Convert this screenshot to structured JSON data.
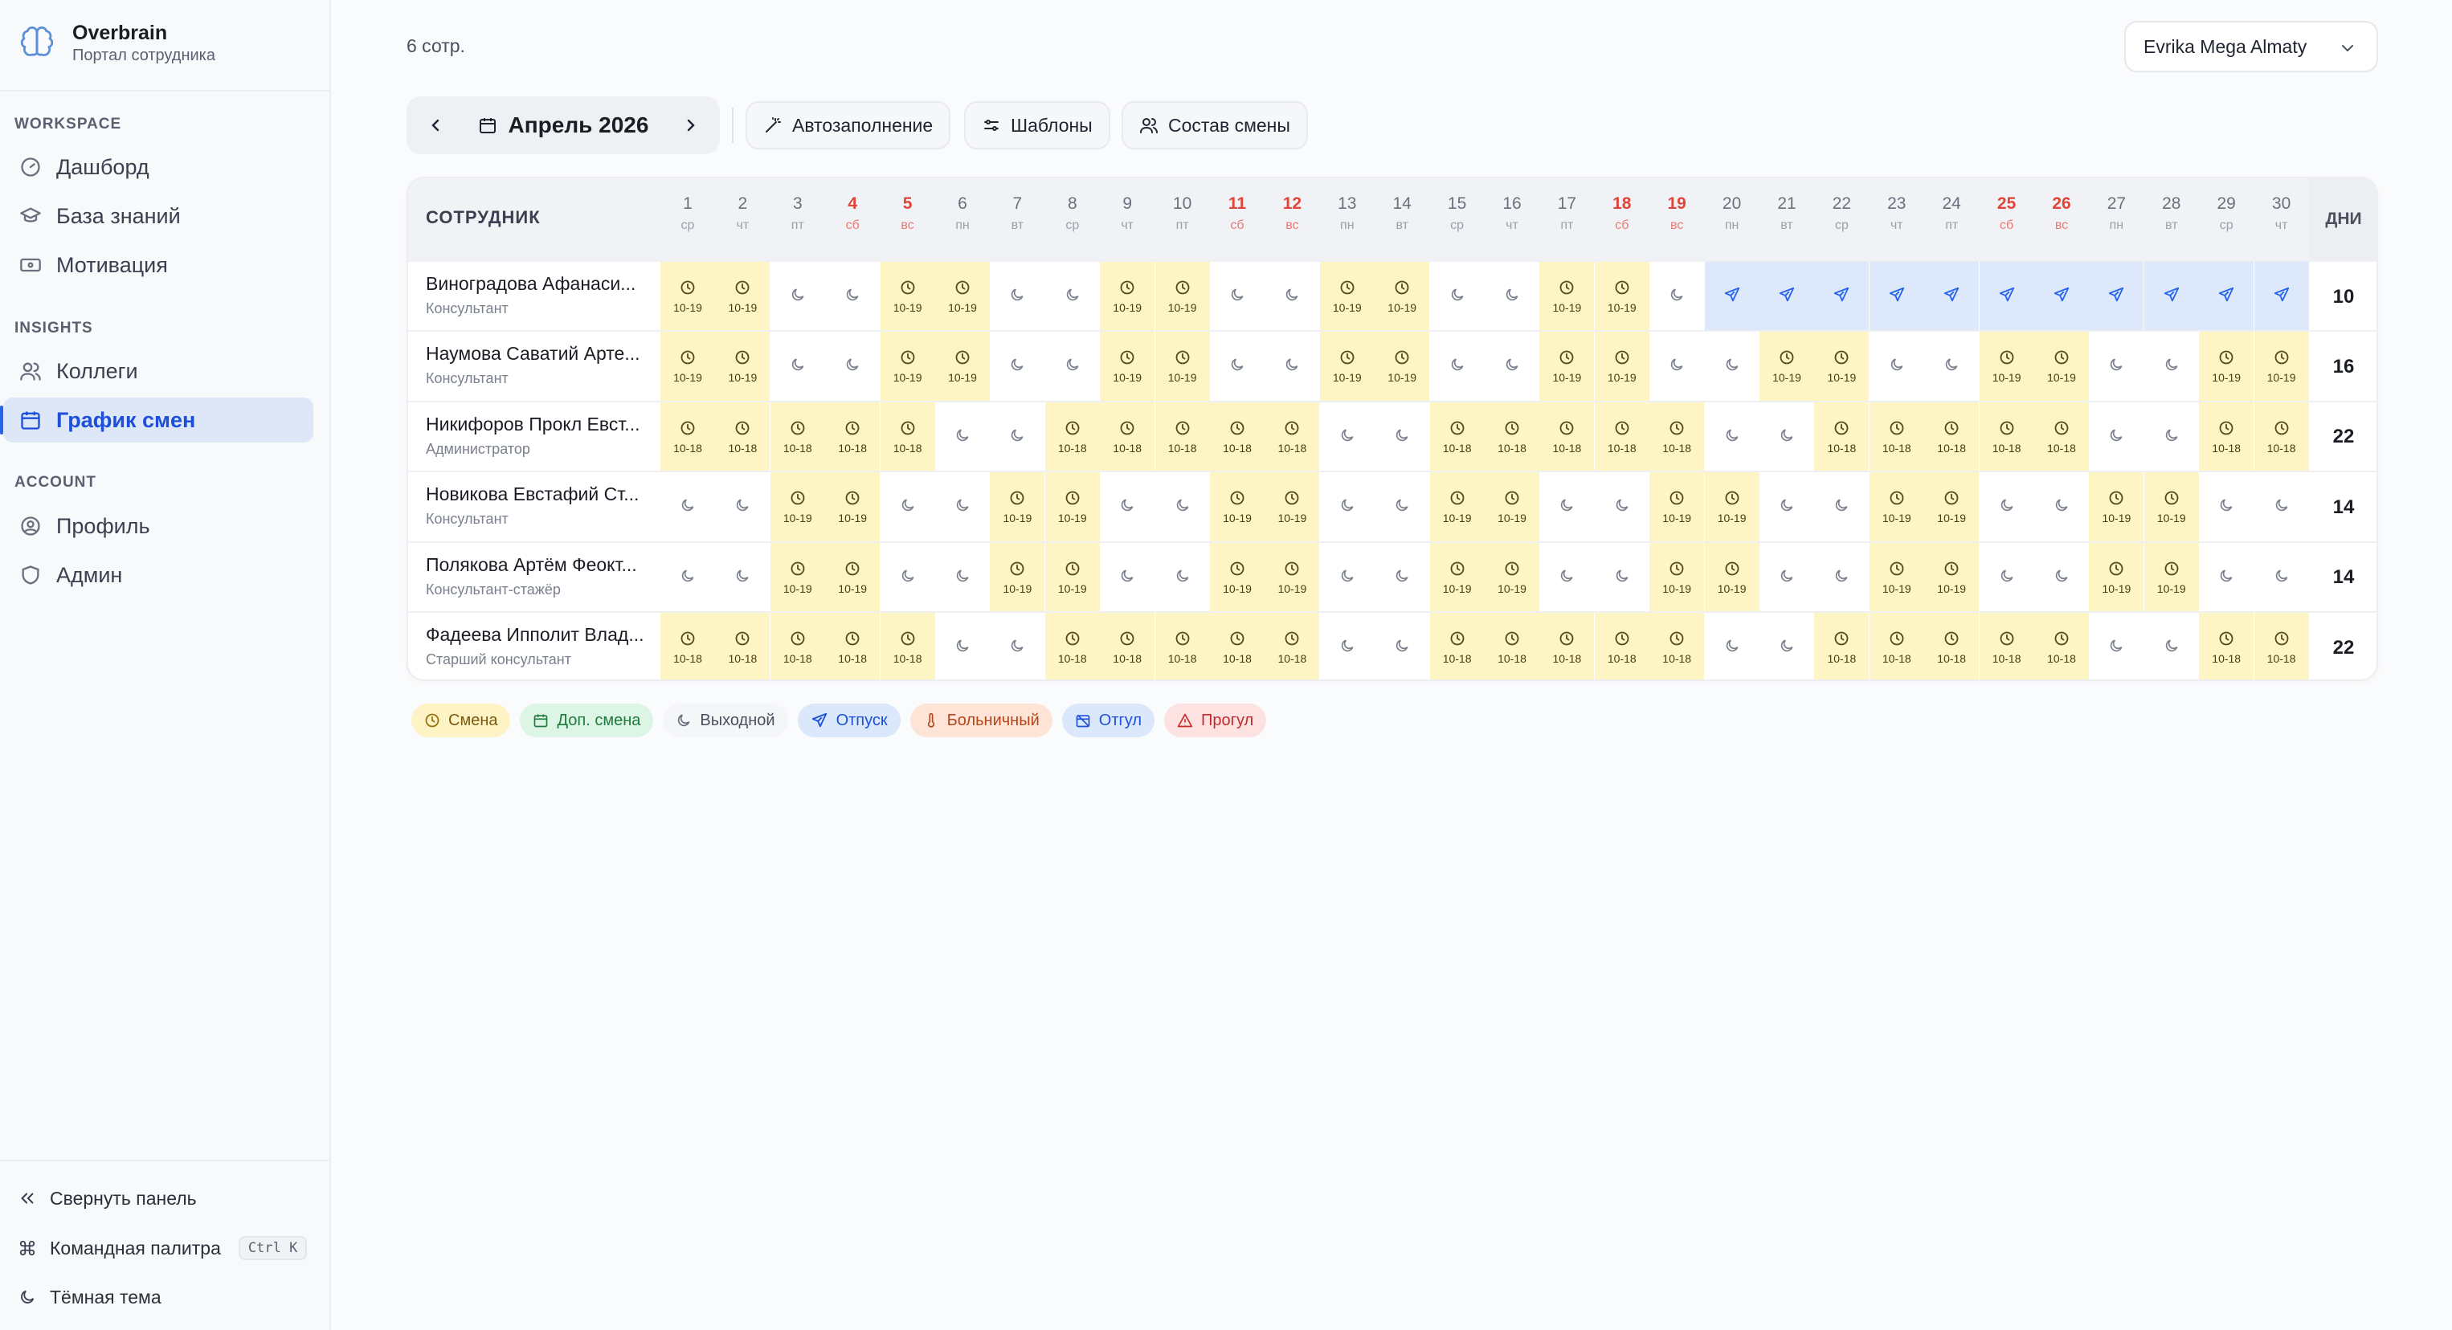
{
  "app": {
    "name": "Overbrain",
    "subtitle": "Портал сотрудника"
  },
  "sidebar": {
    "sections": [
      {
        "title": "WORKSPACE",
        "items": [
          {
            "label": "Дашборд",
            "icon": "gauge-icon"
          },
          {
            "label": "База знаний",
            "icon": "graduation-cap-icon"
          },
          {
            "label": "Мотивация",
            "icon": "banknote-icon"
          }
        ]
      },
      {
        "title": "INSIGHTS",
        "items": [
          {
            "label": "Коллеги",
            "icon": "users-icon"
          },
          {
            "label": "График смен",
            "icon": "calendar-icon",
            "active": true
          }
        ]
      },
      {
        "title": "ACCOUNT",
        "items": [
          {
            "label": "Профиль",
            "icon": "user-circle-icon"
          },
          {
            "label": "Админ",
            "icon": "shield-icon"
          }
        ]
      }
    ],
    "bottom": {
      "collapse": "Свернуть панель",
      "palette": "Командная палитра",
      "palette_kbd": "Ctrl K",
      "theme": "Тёмная тема"
    }
  },
  "header": {
    "employee_count": "6 сотр.",
    "store": "Evrika Mega Almaty"
  },
  "toolbar": {
    "month": "Апрель 2026",
    "autofill": "Автозаполнение",
    "templates": "Шаблоны",
    "crew": "Состав смены"
  },
  "table": {
    "employee_header": "СОТРУДНИК",
    "total_header": "ДНИ",
    "days": [
      {
        "n": "1",
        "w": "ср"
      },
      {
        "n": "2",
        "w": "чт"
      },
      {
        "n": "3",
        "w": "пт"
      },
      {
        "n": "4",
        "w": "сб",
        "we": true
      },
      {
        "n": "5",
        "w": "вс",
        "we": true
      },
      {
        "n": "6",
        "w": "пн"
      },
      {
        "n": "7",
        "w": "вт"
      },
      {
        "n": "8",
        "w": "ср"
      },
      {
        "n": "9",
        "w": "чт"
      },
      {
        "n": "10",
        "w": "пт"
      },
      {
        "n": "11",
        "w": "сб",
        "we": true
      },
      {
        "n": "12",
        "w": "вс",
        "we": true
      },
      {
        "n": "13",
        "w": "пн"
      },
      {
        "n": "14",
        "w": "вт"
      },
      {
        "n": "15",
        "w": "ср"
      },
      {
        "n": "16",
        "w": "чт"
      },
      {
        "n": "17",
        "w": "пт"
      },
      {
        "n": "18",
        "w": "сб",
        "we": true
      },
      {
        "n": "19",
        "w": "вс",
        "we": true
      },
      {
        "n": "20",
        "w": "пн"
      },
      {
        "n": "21",
        "w": "вт"
      },
      {
        "n": "22",
        "w": "ср"
      },
      {
        "n": "23",
        "w": "чт"
      },
      {
        "n": "24",
        "w": "пт"
      },
      {
        "n": "25",
        "w": "сб",
        "we": true
      },
      {
        "n": "26",
        "w": "вс",
        "we": true
      },
      {
        "n": "27",
        "w": "пн"
      },
      {
        "n": "28",
        "w": "вт"
      },
      {
        "n": "29",
        "w": "ср"
      },
      {
        "n": "30",
        "w": "чт"
      }
    ],
    "rows": [
      {
        "name": "Виноградова Афанаси...",
        "role": "Консультант",
        "total": "10",
        "cells": "SSOOSSOOSSOOSSOOSSOVVVVVVVVVVV",
        "time": "10-19"
      },
      {
        "name": "Наумова Саватий Арте...",
        "role": "Консультант",
        "total": "16",
        "cells": "SSOOSSOOSSOOSSOOSSOOSSOOSSOOSS",
        "time": "10-19"
      },
      {
        "name": "Никифоров Прокл Евст...",
        "role": "Администратор",
        "total": "22",
        "cells": "SSSSSOOSSSSSOOSSSSSOOSSSSSOOSS",
        "time": "10-18"
      },
      {
        "name": "Новикова Евстафий Ст...",
        "role": "Консультант",
        "total": "14",
        "cells": "OOSSOOSSOOSSOOSSOOSSOOSSOOSSOO",
        "time": "10-19"
      },
      {
        "name": "Полякова Артём Феокт...",
        "role": "Консультант-стажёр",
        "total": "14",
        "cells": "OOSSOOSSOOSSOOSSOOSSOOSSOOSSOO",
        "time": "10-19"
      },
      {
        "name": "Фадеева Ипполит Влад...",
        "role": "Старший консультант",
        "total": "22",
        "cells": "SSSSSOOSSSSSOOSSSSSOOSSSSSOOSS",
        "time": "10-18"
      }
    ]
  },
  "legend": [
    {
      "label": "Смена",
      "kind": "shift",
      "icon": "clock-icon"
    },
    {
      "label": "Доп. смена",
      "kind": "extra",
      "icon": "calendar-plus-icon"
    },
    {
      "label": "Выходной",
      "kind": "off",
      "icon": "moon-icon"
    },
    {
      "label": "Отпуск",
      "kind": "vac",
      "icon": "plane-icon"
    },
    {
      "label": "Больничный",
      "kind": "sick",
      "icon": "thermometer-icon"
    },
    {
      "label": "Отгул",
      "kind": "leave",
      "icon": "calendar-off-icon"
    },
    {
      "label": "Прогул",
      "kind": "abs",
      "icon": "alert-triangle-icon"
    }
  ],
  "colors": {
    "accent": "#2563eb",
    "shift": "#fdf6c4",
    "vacation": "#dde9fb",
    "weekend": "#e0453a"
  }
}
